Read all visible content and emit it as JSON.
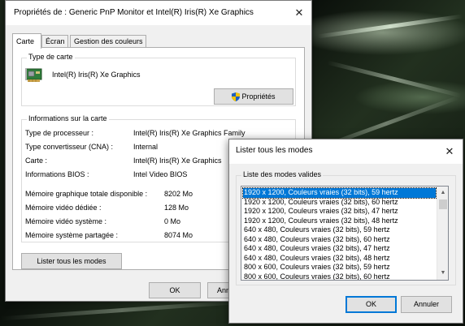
{
  "main_window": {
    "title": "Propriétés de : Generic PnP Monitor et Intel(R) Iris(R) Xe Graphics",
    "close_glyph": "✕",
    "tabs": [
      {
        "label": "Carte"
      },
      {
        "label": "Écran"
      },
      {
        "label": "Gestion des couleurs"
      }
    ],
    "adapter_type": {
      "group_label": "Type de carte",
      "adapter_name": "Intel(R) Iris(R) Xe Graphics",
      "properties_button": "Propriétés"
    },
    "adapter_info": {
      "group_label": "Informations sur la carte",
      "rows": [
        {
          "label": "Type de processeur :",
          "value": "Intel(R) Iris(R) Xe Graphics Family"
        },
        {
          "label": "Type convertisseur (CNA) :",
          "value": "Internal"
        },
        {
          "label": "Carte :",
          "value": "Intel(R) Iris(R) Xe Graphics"
        },
        {
          "label": "Informations BIOS :",
          "value": "Intel Video BIOS"
        }
      ],
      "memory_rows": [
        {
          "label": "Mémoire graphique totale disponible :",
          "value": "8202 Mo"
        },
        {
          "label": "Mémoire vidéo dédiée :",
          "value": "128 Mo"
        },
        {
          "label": "Mémoire vidéo système :",
          "value": "0 Mo"
        },
        {
          "label": "Mémoire système partagée :",
          "value": "8074 Mo"
        }
      ]
    },
    "list_all_modes_button": "Lister tous les modes",
    "ok_button": "OK",
    "cancel_button_partial": "Ann"
  },
  "modes_dialog": {
    "title": "Lister tous les modes",
    "close_glyph": "✕",
    "group_label": "Liste des modes valides",
    "modes": [
      "1920 x 1200, Couleurs vraies (32 bits), 59 hertz",
      "1920 x 1200, Couleurs vraies (32 bits), 60 hertz",
      "1920 x 1200, Couleurs vraies (32 bits), 47 hertz",
      "1920 x 1200, Couleurs vraies (32 bits), 48 hertz",
      "640 x 480, Couleurs vraies (32 bits), 59 hertz",
      "640 x 480, Couleurs vraies (32 bits), 60 hertz",
      "640 x 480, Couleurs vraies (32 bits), 47 hertz",
      "640 x 480, Couleurs vraies (32 bits), 48 hertz",
      "800 x 600, Couleurs vraies (32 bits), 59 hertz",
      "800 x 600, Couleurs vraies (32 bits), 60 hertz"
    ],
    "selected_index": 0,
    "scroll_up_glyph": "▲",
    "scroll_down_glyph": "▼",
    "ok_button": "OK",
    "cancel_button": "Annuler"
  },
  "colors": {
    "accent": "#0078d7",
    "window_bg": "#f0f0f0"
  }
}
